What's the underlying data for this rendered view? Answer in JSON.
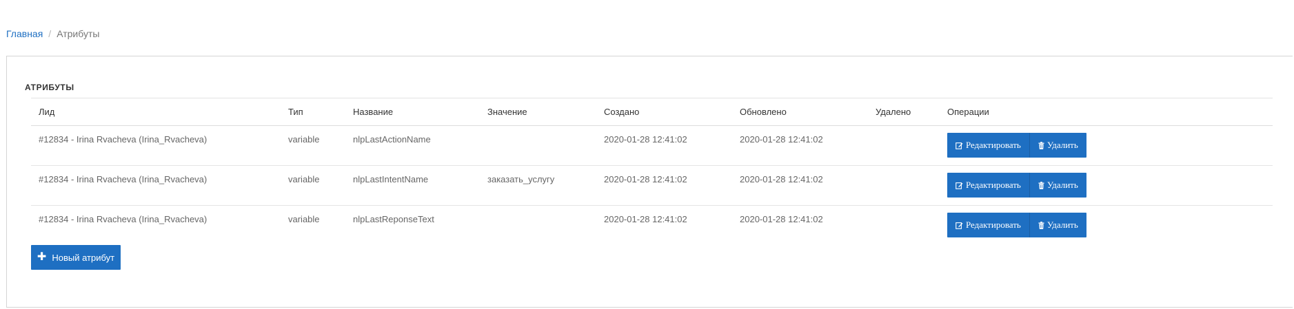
{
  "breadcrumb": {
    "home": "Главная",
    "separator": "/",
    "current": "Атрибуты"
  },
  "panel": {
    "title": "АТРИБУТЫ"
  },
  "table": {
    "columns": [
      "Лид",
      "Тип",
      "Название",
      "Значение",
      "Создано",
      "Обновлено",
      "Удалено",
      "Операции"
    ],
    "rows": [
      {
        "lead": "#12834 - Irina Rvacheva (Irina_Rvacheva)",
        "type": "variable",
        "name": "nlpLastActionName",
        "value": "",
        "created": "2020-01-28 12:41:02",
        "updated": "2020-01-28 12:41:02",
        "deleted": ""
      },
      {
        "lead": "#12834 - Irina Rvacheva (Irina_Rvacheva)",
        "type": "variable",
        "name": "nlpLastIntentName",
        "value": "заказать_услугу",
        "created": "2020-01-28 12:41:02",
        "updated": "2020-01-28 12:41:02",
        "deleted": ""
      },
      {
        "lead": "#12834 - Irina Rvacheva (Irina_Rvacheva)",
        "type": "variable",
        "name": "nlpLastReponseText",
        "value": "",
        "created": "2020-01-28 12:41:02",
        "updated": "2020-01-28 12:41:02",
        "deleted": ""
      }
    ],
    "edit_label": "Редактировать",
    "delete_label": "Удалить"
  },
  "actions": {
    "new_label": "Новый атрибут"
  },
  "colors": {
    "primary": "#1e6fc2",
    "link": "#1e6fc2",
    "border": "#d4d4d4"
  },
  "icons": {
    "edit": "edit-icon",
    "delete": "trash-icon",
    "add": "plus-icon"
  }
}
